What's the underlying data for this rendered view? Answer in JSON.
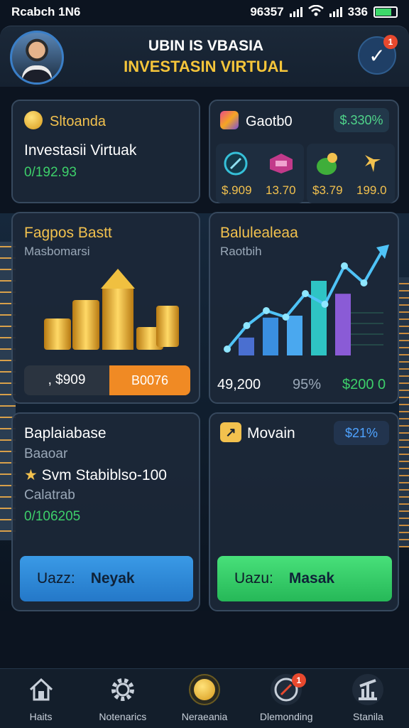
{
  "status_bar": {
    "left_text": "Rcabch 1N6",
    "time": "96357",
    "battery_text": "336"
  },
  "header": {
    "title_line1": "UBIN IS VBASIA",
    "title_line2": "INVESTASIN VIRTUAL",
    "notification_count": "1"
  },
  "card_stock": {
    "title": "Sltoanda",
    "subtitle": "Investasii Virtuak",
    "value": "0/192.93"
  },
  "card_assets": {
    "title": "Gaotb0",
    "badge": "$.330%",
    "items": [
      {
        "icon": "compass-icon",
        "value": "$.909"
      },
      {
        "icon": "ticket-icon",
        "value": "13.70"
      },
      {
        "icon": "money-bag-icon",
        "value": "$3.79"
      },
      {
        "icon": "sparkle-icon",
        "value": "199.0"
      }
    ]
  },
  "card_gold": {
    "title": "Fagpos Bastt",
    "subtitle": "Masbomarsi",
    "amount": ", $909",
    "change": "B0076"
  },
  "card_chart": {
    "title": "Balulealeaa",
    "subtitle": "Raotbih",
    "stats": [
      "49,200",
      "95%",
      "$200 0"
    ],
    "chart_data": {
      "type": "bar",
      "values": [
        18,
        38,
        40,
        75,
        62
      ],
      "line_values": [
        6,
        28,
        42,
        36,
        58,
        48,
        84,
        68,
        100
      ],
      "colors": [
        "#4a6fd0",
        "#3a8fe0",
        "#4aa8ef",
        "#2ec4c4",
        "#8a5bd6"
      ],
      "line_color": "#4fc3f7"
    }
  },
  "card_balance": {
    "title": "Baplaiabase",
    "line2": "Baaoar",
    "line3": "Svm Stabiblso-100",
    "line4": "Calatrab",
    "value": "0/106205",
    "button_prefix": "Uazz:",
    "button_label": "Neyak"
  },
  "card_movain": {
    "title": "Movain",
    "badge": "$21%",
    "button_prefix": "Uazu:",
    "button_label": "Masak"
  },
  "bottom_nav": [
    {
      "icon": "home-icon",
      "label": "Haits"
    },
    {
      "icon": "gear-icon",
      "label": "Notenarics"
    },
    {
      "icon": "coin-icon",
      "label": "Neraeania"
    },
    {
      "icon": "compass-icon",
      "label": "Dlemonding",
      "badge": "1"
    },
    {
      "icon": "chart-icon",
      "label": "Stanila"
    }
  ],
  "colors": {
    "accent_gold": "#f2c14e",
    "accent_green": "#3dcf6a",
    "button_blue": "#2c88d8",
    "button_green": "#38d66b"
  }
}
